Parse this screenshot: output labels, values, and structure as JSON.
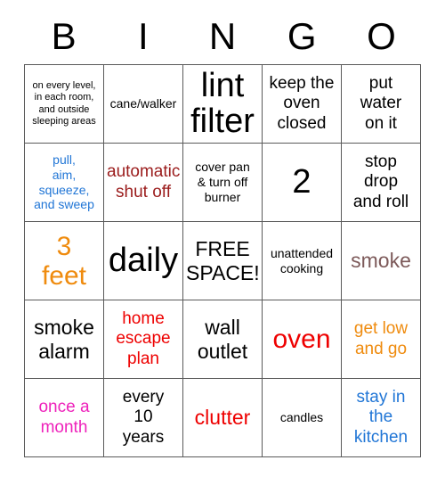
{
  "header": {
    "letters": [
      "B",
      "I",
      "N",
      "G",
      "O"
    ]
  },
  "colors": {
    "black": "#000000",
    "blue": "#2176d6",
    "maroon": "#9b1c1c",
    "orange": "#ef8b0e",
    "red": "#ee0000",
    "magenta": "#ee22bb",
    "mauve": "#7d5a5a",
    "grid_line": "#5a5a5a",
    "background": "#ffffff"
  },
  "grid": {
    "columns": 5,
    "rows": 5,
    "cells": [
      {
        "text": "on every level,\nin each room,\nand outside\nsleeping areas",
        "color": "#000000",
        "size": "sz-xs"
      },
      {
        "text": "cane/walker",
        "color": "#000000",
        "size": "sz-sm"
      },
      {
        "text": "lint\nfilter",
        "color": "#000000",
        "size": "sz-xxl"
      },
      {
        "text": "keep the\noven\nclosed",
        "color": "#000000",
        "size": "sz-md"
      },
      {
        "text": "put\nwater\non it",
        "color": "#000000",
        "size": "sz-md"
      },
      {
        "text": "pull,\naim,\nsqueeze,\nand sweep",
        "color": "#2176d6",
        "size": "sz-sm"
      },
      {
        "text": "automatic\nshut off",
        "color": "#9b1c1c",
        "size": "sz-md"
      },
      {
        "text": "cover pan\n& turn off\nburner",
        "color": "#000000",
        "size": "sz-sm"
      },
      {
        "text": "2",
        "color": "#000000",
        "size": "sz-xxl"
      },
      {
        "text": "stop\ndrop\nand roll",
        "color": "#000000",
        "size": "sz-md"
      },
      {
        "text": "3\nfeet",
        "color": "#ef8b0e",
        "size": "sz-xl"
      },
      {
        "text": "daily",
        "color": "#000000",
        "size": "sz-xxl"
      },
      {
        "text": "FREE\nSPACE!",
        "color": "#000000",
        "size": "sz-lg"
      },
      {
        "text": "unattended\ncooking",
        "color": "#000000",
        "size": "sz-sm"
      },
      {
        "text": "smoke",
        "color": "#7d5a5a",
        "size": "sz-lg"
      },
      {
        "text": "smoke\nalarm",
        "color": "#000000",
        "size": "sz-lg"
      },
      {
        "text": "home\nescape\nplan",
        "color": "#ee0000",
        "size": "sz-md"
      },
      {
        "text": "wall\noutlet",
        "color": "#000000",
        "size": "sz-lg"
      },
      {
        "text": "oven",
        "color": "#ee0000",
        "size": "sz-xl"
      },
      {
        "text": "get low\nand go",
        "color": "#ef8b0e",
        "size": "sz-md"
      },
      {
        "text": "once a\nmonth",
        "color": "#ee22bb",
        "size": "sz-md"
      },
      {
        "text": "every\n10\nyears",
        "color": "#000000",
        "size": "sz-md"
      },
      {
        "text": "clutter",
        "color": "#ee0000",
        "size": "sz-lg"
      },
      {
        "text": "candles",
        "color": "#000000",
        "size": "sz-sm"
      },
      {
        "text": "stay in\nthe\nkitchen",
        "color": "#2176d6",
        "size": "sz-md"
      }
    ]
  }
}
